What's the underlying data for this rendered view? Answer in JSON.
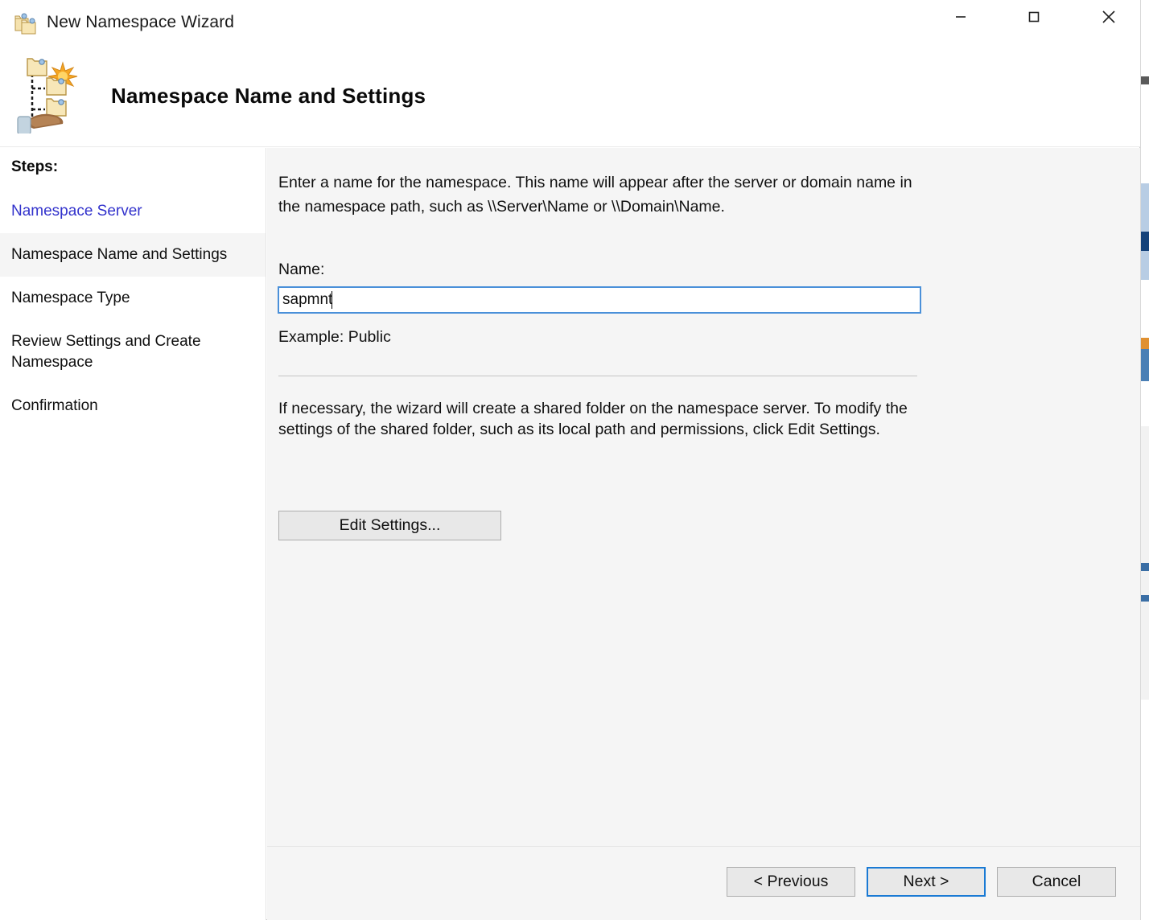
{
  "window": {
    "title": "New Namespace Wizard",
    "title_icon": "namespace-folders-icon",
    "controls": {
      "minimize": "minimize-icon",
      "maximize": "maximize-icon",
      "close": "close-icon"
    }
  },
  "header": {
    "title": "Namespace Name and Settings",
    "icon": "namespace-tree-icon"
  },
  "sidebar": {
    "heading": "Steps:",
    "items": [
      {
        "label": "Namespace Server",
        "state": "link"
      },
      {
        "label": "Namespace Name and Settings",
        "state": "current"
      },
      {
        "label": "Namespace Type",
        "state": "pending"
      },
      {
        "label": "Review Settings and Create Namespace",
        "state": "pending"
      },
      {
        "label": "Confirmation",
        "state": "pending"
      }
    ]
  },
  "content": {
    "intro": "Enter a name for the namespace. This name will appear after the server or domain name in the namespace path, such as \\\\Server\\Name or \\\\Domain\\Name.",
    "name_label": "Name:",
    "name_value": "sapmnt",
    "name_placeholder": "",
    "example": "Example: Public",
    "shared_folder_text": "If necessary, the wizard will create a shared folder on the namespace server. To modify the settings of the shared folder, such as its local path and permissions, click Edit Settings.",
    "edit_settings_label": "Edit Settings..."
  },
  "footer": {
    "previous_label": "< Previous",
    "next_label": "Next >",
    "cancel_label": "Cancel",
    "focused_button": "Next >"
  },
  "colors": {
    "link": "#3333cc",
    "content_bg": "#f5f5f5",
    "focus_border": "#1a7ad4",
    "input_border": "#4a90d9"
  }
}
